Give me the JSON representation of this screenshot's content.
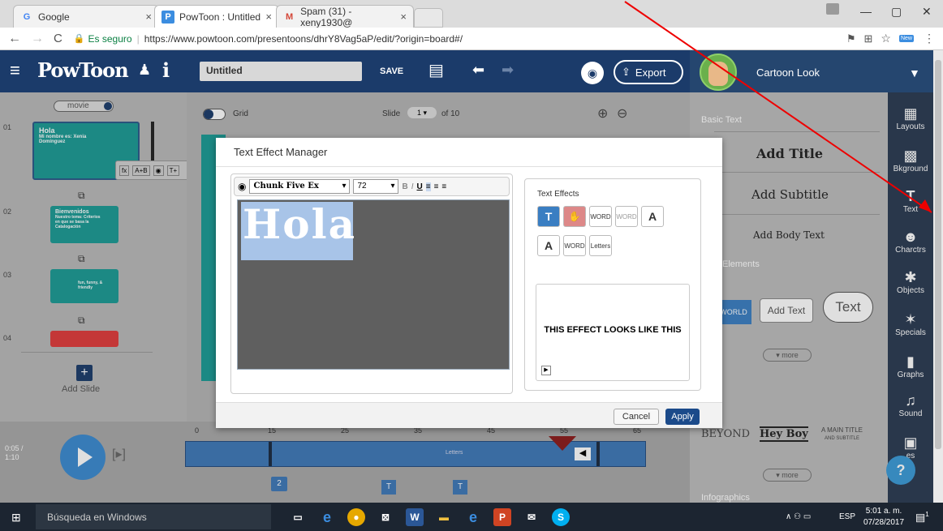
{
  "browser": {
    "tabs": [
      {
        "label": "Google",
        "icon": "G"
      },
      {
        "label": "PowToon : Untitled",
        "icon": "P"
      },
      {
        "label": "Spam (31) - xeny1930@",
        "icon": "M"
      }
    ],
    "secure_label": "Es seguro",
    "url": "https://www.powtoon.com/presentoons/dhrY8Vag5aP/edit/?origin=board#/",
    "ext_badge": "New"
  },
  "powtoon": {
    "logo": "PowToon",
    "doc_title": "Untitled",
    "save_label": "SAVE",
    "export_label": "Export",
    "look_label": "Cartoon Look"
  },
  "canvas": {
    "movie_label": "movie",
    "grid_label": "Grid",
    "slide_label": "Slide",
    "slide_current": "1",
    "slide_of": "of 10"
  },
  "slides": {
    "items": [
      {
        "num": "01",
        "title": "Hola",
        "sub": "Mi nombre es: Xenia Dominguez"
      },
      {
        "num": "02",
        "title": "Bienvenidos",
        "sub": "Nuestro tema: Criterios en que se basa la Catalogación"
      },
      {
        "num": "03",
        "title": "",
        "sub": "fun, funny, & friendly"
      },
      {
        "num": "04",
        "title": "",
        "sub": ""
      }
    ],
    "add_slide": "Add Slide"
  },
  "modal": {
    "title": "Text Effect Manager",
    "font_name": "Chunk Five Ex",
    "font_size": "72",
    "editor_text": "Hola",
    "effects_title": "Text Effects",
    "effects_preview": "THIS EFFECT LOOKS LIKE THIS",
    "effect_words": [
      "WORD",
      "WORD",
      "WORD",
      "Letters"
    ],
    "cancel_label": "Cancel",
    "apply_label": "Apply"
  },
  "textpanel": {
    "basic_text": "Basic Text",
    "add_title": "Add Title",
    "add_subtitle": "Add Subtitle",
    "add_body": "Add Body Text",
    "elements": "Elements",
    "world": "WORLD",
    "add_text": "Add Text",
    "cloud_text": "Text",
    "more1": "more",
    "beyond": "BEYOND",
    "hey_boy": "Hey Boy",
    "main_title": "A MAIN TITLE",
    "and_subtitle": "AND SUBTITLE",
    "more2": "more",
    "infographics": "Infographics"
  },
  "rail": [
    {
      "label": "Layouts",
      "icon": "▦"
    },
    {
      "label": "Bkground",
      "icon": "▩"
    },
    {
      "label": "Text",
      "icon": "T"
    },
    {
      "label": "Charctrs",
      "icon": "☻"
    },
    {
      "label": "Objects",
      "icon": "✱"
    },
    {
      "label": "Specials",
      "icon": "✶"
    },
    {
      "label": "Graphs",
      "icon": "▮"
    },
    {
      "label": "Sound",
      "icon": "♫"
    },
    {
      "label": "es",
      "icon": "▣"
    }
  ],
  "timeline": {
    "time_current": "0:05 /",
    "time_total": "1:10",
    "ticks": [
      "0",
      "15",
      "25",
      "35",
      "45",
      "55",
      "65"
    ],
    "track_label": "Letters",
    "marker_num": "2",
    "help": "?"
  },
  "taskbar": {
    "search": "Búsqueda en Windows",
    "lang": "ESP",
    "time": "5:01 a. m.",
    "date": "07/28/2017",
    "notif": "1"
  }
}
